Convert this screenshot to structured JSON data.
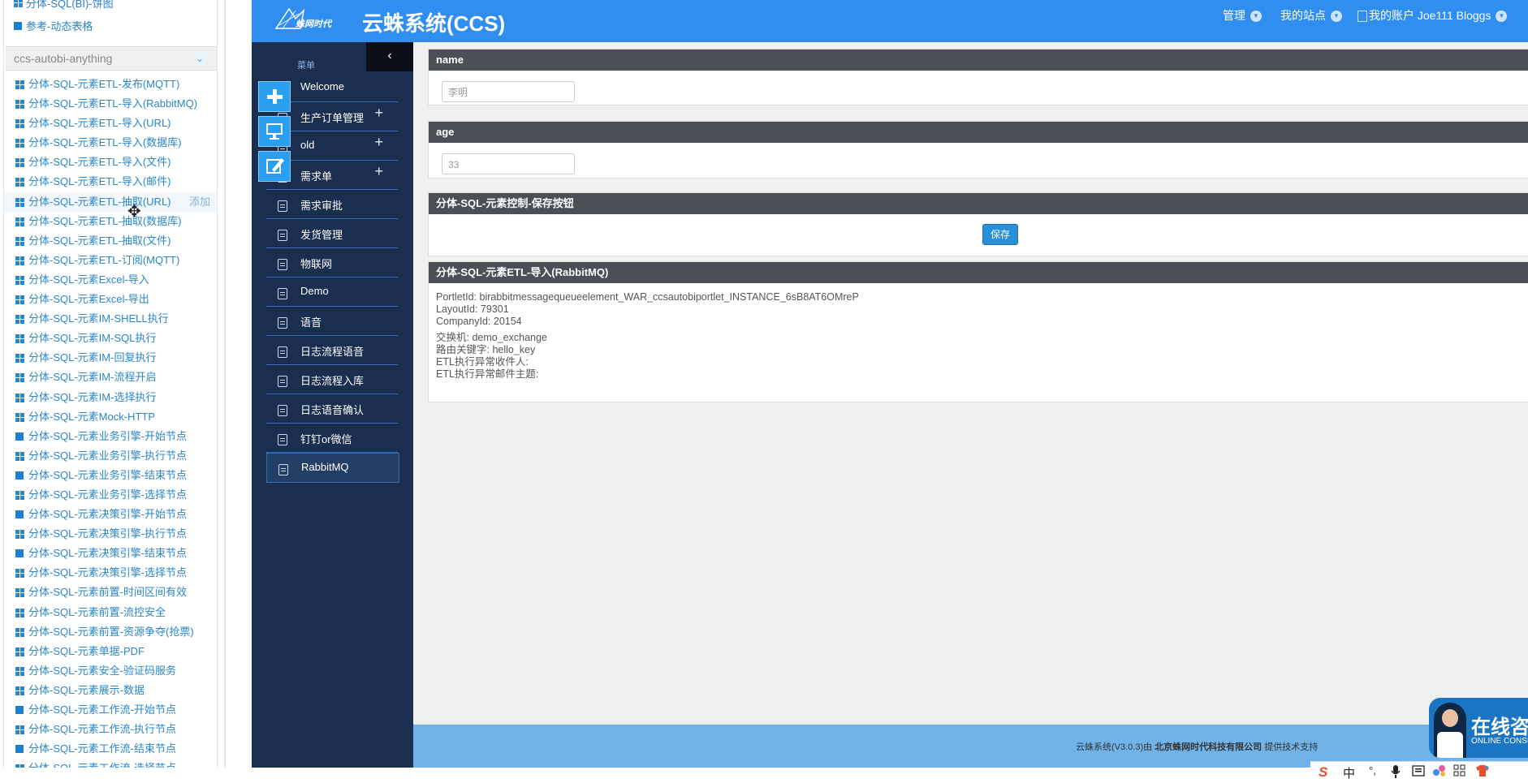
{
  "palette": {
    "top_items": [
      {
        "label": "分体-SQL(BI)-饼图",
        "icon": "grid-icon"
      },
      {
        "label": "参考-动态表格",
        "icon": "square-icon"
      }
    ],
    "group_title": "ccs-autobi-anything",
    "items": [
      {
        "label": "分体-SQL-元素ETL-发布(MQTT)",
        "icon": "grid-icon"
      },
      {
        "label": "分体-SQL-元素ETL-导入(RabbitMQ)",
        "icon": "grid-icon"
      },
      {
        "label": "分体-SQL-元素ETL-导入(URL)",
        "icon": "grid-icon"
      },
      {
        "label": "分体-SQL-元素ETL-导入(数据库)",
        "icon": "grid-icon"
      },
      {
        "label": "分体-SQL-元素ETL-导入(文件)",
        "icon": "grid-icon"
      },
      {
        "label": "分体-SQL-元素ETL-导入(邮件)",
        "icon": "grid-icon"
      },
      {
        "label": "分体-SQL-元素ETL-抽取(URL)",
        "icon": "grid-icon",
        "add": "添加",
        "highlight": true
      },
      {
        "label": "分体-SQL-元素ETL-抽取(数据库)",
        "icon": "grid-icon"
      },
      {
        "label": "分体-SQL-元素ETL-抽取(文件)",
        "icon": "grid-icon"
      },
      {
        "label": "分体-SQL-元素ETL-订阅(MQTT)",
        "icon": "grid-icon"
      },
      {
        "label": "分体-SQL-元素Excel-导入",
        "icon": "grid-icon"
      },
      {
        "label": "分体-SQL-元素Excel-导出",
        "icon": "grid-icon"
      },
      {
        "label": "分体-SQL-元素IM-SHELL执行",
        "icon": "grid-icon"
      },
      {
        "label": "分体-SQL-元素IM-SQL执行",
        "icon": "grid-icon"
      },
      {
        "label": "分体-SQL-元素IM-回复执行",
        "icon": "grid-icon"
      },
      {
        "label": "分体-SQL-元素IM-流程开启",
        "icon": "grid-icon"
      },
      {
        "label": "分体-SQL-元素IM-选择执行",
        "icon": "grid-icon"
      },
      {
        "label": "分体-SQL-元素Mock-HTTP",
        "icon": "grid-icon"
      },
      {
        "label": "分体-SQL-元素业务引擎-开始节点",
        "icon": "square-icon"
      },
      {
        "label": "分体-SQL-元素业务引擎-执行节点",
        "icon": "grid-icon"
      },
      {
        "label": "分体-SQL-元素业务引擎-结束节点",
        "icon": "square-icon"
      },
      {
        "label": "分体-SQL-元素业务引擎-选择节点",
        "icon": "grid-icon"
      },
      {
        "label": "分体-SQL-元素决策引擎-开始节点",
        "icon": "square-icon"
      },
      {
        "label": "分体-SQL-元素决策引擎-执行节点",
        "icon": "grid-icon"
      },
      {
        "label": "分体-SQL-元素决策引擎-结束节点",
        "icon": "square-icon"
      },
      {
        "label": "分体-SQL-元素决策引擎-选择节点",
        "icon": "grid-icon"
      },
      {
        "label": "分体-SQL-元素前置-时间区间有效",
        "icon": "grid-icon"
      },
      {
        "label": "分体-SQL-元素前置-流控安全",
        "icon": "grid-icon"
      },
      {
        "label": "分体-SQL-元素前置-资源争夺(抢票)",
        "icon": "grid-icon"
      },
      {
        "label": "分体-SQL-元素单据-PDF",
        "icon": "grid-icon"
      },
      {
        "label": "分体-SQL-元素安全-验证码服务",
        "icon": "grid-icon"
      },
      {
        "label": "分体-SQL-元素展示-数据",
        "icon": "grid-icon"
      },
      {
        "label": "分体-SQL-元素工作流-开始节点",
        "icon": "square-icon"
      },
      {
        "label": "分体-SQL-元素工作流-执行节点",
        "icon": "grid-icon"
      },
      {
        "label": "分体-SQL-元素工作流-结束节点",
        "icon": "square-icon"
      },
      {
        "label": "分体-SQL-元素工作流-选择节点",
        "icon": "grid-icon"
      }
    ]
  },
  "header": {
    "title": "云蛛系统(CCS)",
    "nav_manage": "管理",
    "nav_sites": "我的站点",
    "nav_account": "我的账户 Joe111 Bloggs"
  },
  "menu": {
    "caption": "菜单",
    "collapse": "‹",
    "items": [
      {
        "label": "Welcome",
        "plus": ""
      },
      {
        "label": "生产订单管理",
        "plus": "+"
      },
      {
        "label": "old",
        "plus": "+"
      },
      {
        "label": "需求单",
        "plus": "+"
      },
      {
        "label": "需求审批",
        "plus": ""
      },
      {
        "label": "发货管理",
        "plus": ""
      },
      {
        "label": "物联网",
        "plus": ""
      },
      {
        "label": "Demo",
        "plus": ""
      },
      {
        "label": "语音",
        "plus": ""
      },
      {
        "label": "日志流程语音",
        "plus": ""
      },
      {
        "label": "日志流程入库",
        "plus": ""
      },
      {
        "label": "日志语音确认",
        "plus": ""
      },
      {
        "label": "钉钉or微信",
        "plus": ""
      },
      {
        "label": "RabbitMQ",
        "plus": "",
        "active": true
      }
    ],
    "tools": [
      "add-icon",
      "monitor-icon",
      "edit-icon"
    ]
  },
  "content": {
    "name_title": "name",
    "name_value": "李明",
    "age_title": "age",
    "age_value": "33",
    "save_title": "分体-SQL-元素控制-保存按钮",
    "save_label": "保存",
    "info_title": "分体-SQL-元素ETL-导入(RabbitMQ)",
    "info_lines": [
      "PortletId: birabbitmessagequeueelement_WAR_ccsautobiportlet_INSTANCE_6sB8AT6OMreP",
      "LayoutId: 79301",
      "CompanyId: 20154",
      "交换机: demo_exchange",
      "路由关键字: hello_key",
      "ETL执行异常收件人:",
      "ETL执行异常邮件主题:"
    ]
  },
  "footer": {
    "prefix": "云蛛系统(V3.0.3)由 ",
    "company": "北京蛛网时代科技有限公司",
    "suffix": " 提供技术支持"
  },
  "consult": {
    "title": "在线咨",
    "subtitle": "ONLINE CONSUL"
  },
  "ime": {
    "items": [
      "S",
      "中",
      "°,",
      "mic-icon",
      "keyboard-icon",
      "skin-icon",
      "grid-icon",
      "shirt-icon"
    ],
    "zh": "中"
  }
}
